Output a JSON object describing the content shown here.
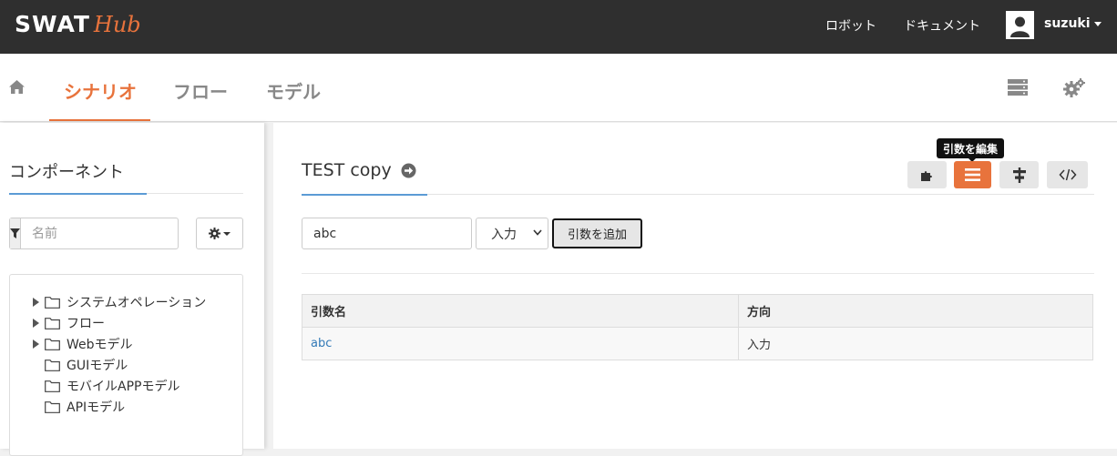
{
  "brand": {
    "main": "SWAT",
    "accent": "Hub",
    "accent_color": "#e8733c"
  },
  "topnav": {
    "robot_label": "ロボット",
    "docs_label": "ドキュメント",
    "user_name": "suzuki"
  },
  "subnav": {
    "home_icon": "home-icon",
    "tabs": [
      {
        "label": "シナリオ",
        "active": true
      },
      {
        "label": "フロー",
        "active": false
      },
      {
        "label": "モデル",
        "active": false
      }
    ],
    "right_icons": [
      "server-icon",
      "gears-icon"
    ]
  },
  "components": {
    "title": "コンポーネント",
    "filter_placeholder": "名前",
    "tree": [
      {
        "label": "システムオペレーション",
        "expandable": true
      },
      {
        "label": "フロー",
        "expandable": true
      },
      {
        "label": "Webモデル",
        "expandable": true
      },
      {
        "label": "GUIモデル",
        "expandable": false
      },
      {
        "label": "モバイルAPPモデル",
        "expandable": false
      },
      {
        "label": "APIモデル",
        "expandable": false
      }
    ]
  },
  "scenario": {
    "title": "TEST copy",
    "toolbar": {
      "tooltip": "引数を編集",
      "buttons": [
        "puzzle-icon",
        "list-icon",
        "align-icon",
        "code-icon"
      ],
      "active_index": 1
    },
    "arg_input_value": "abc",
    "direction_selected": "入力",
    "add_button_label": "引数を追加",
    "table": {
      "headers": [
        "引数名",
        "方向"
      ],
      "rows": [
        [
          "abc",
          "入力"
        ]
      ]
    }
  }
}
